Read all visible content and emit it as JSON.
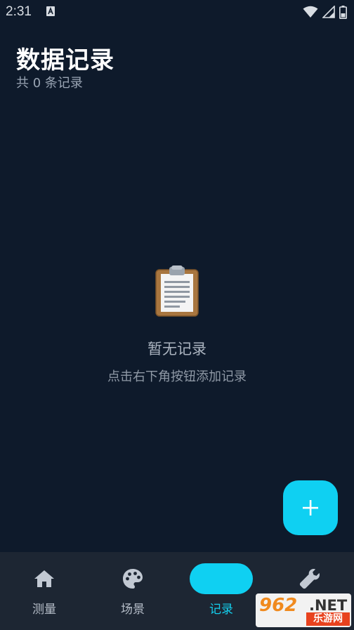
{
  "status_bar": {
    "time": "2:31",
    "notification_icon": "a-notification-icon",
    "icons": [
      "wifi-icon",
      "signal-icon",
      "battery-icon"
    ]
  },
  "header": {
    "title": "数据记录",
    "subtitle": "共 0 条记录"
  },
  "empty_state": {
    "icon": "clipboard-icon",
    "title": "暂无记录",
    "hint": "点击右下角按钮添加记录"
  },
  "fab": {
    "icon": "plus-icon"
  },
  "bottom_nav": {
    "items": [
      {
        "label": "测量",
        "icon": "home-icon",
        "active": false
      },
      {
        "label": "场景",
        "icon": "palette-icon",
        "active": false
      },
      {
        "label": "记录",
        "icon": "",
        "active": true
      },
      {
        "label": "",
        "icon": "wrench-icon",
        "active": false
      }
    ]
  },
  "watermark": {
    "brand": "962",
    "suffix": ".NET",
    "caption": "乐游网"
  },
  "colors": {
    "background": "#0e1a2b",
    "nav_background": "#1d2633",
    "accent": "#0fd0f2",
    "title": "#ffffff",
    "muted_text": "#9aa5b4"
  }
}
